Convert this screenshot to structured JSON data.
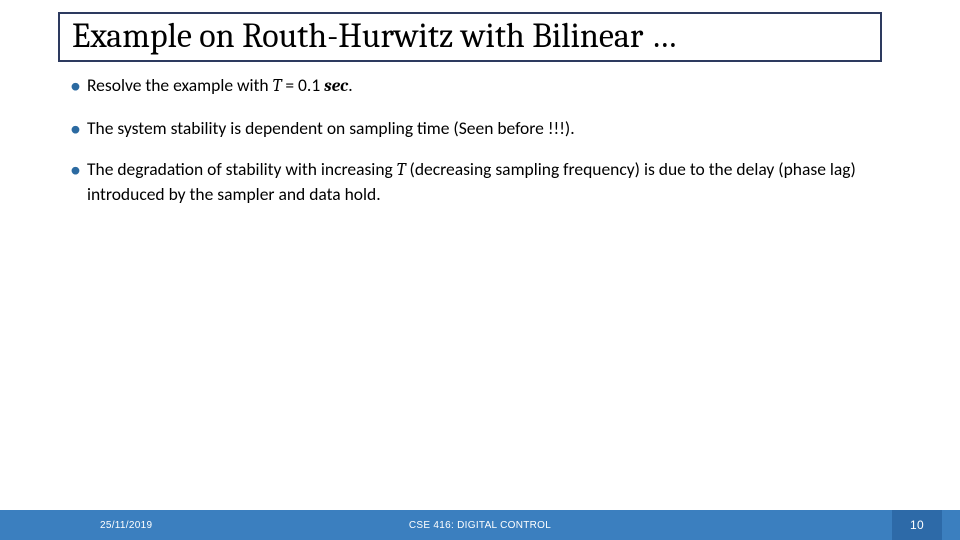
{
  "title": "Example on Routh-Hurwitz with Bilinear …",
  "bullets": [
    {
      "pre": "Resolve the example with ",
      "var": "T",
      "eq": " = 0.1 ",
      "unit": "sec",
      "post": "."
    },
    {
      "text": "The system stability is dependent on sampling time (Seen before !!!)."
    },
    {
      "pre": "The degradation of stability with increasing ",
      "var": "T",
      "post": " (decreasing sampling frequency) is due to the delay (phase lag) introduced by the sampler and data hold."
    }
  ],
  "footer": {
    "date": "25/11/2019",
    "course": "CSE 416: DIGITAL CONTROL",
    "page": "10"
  }
}
